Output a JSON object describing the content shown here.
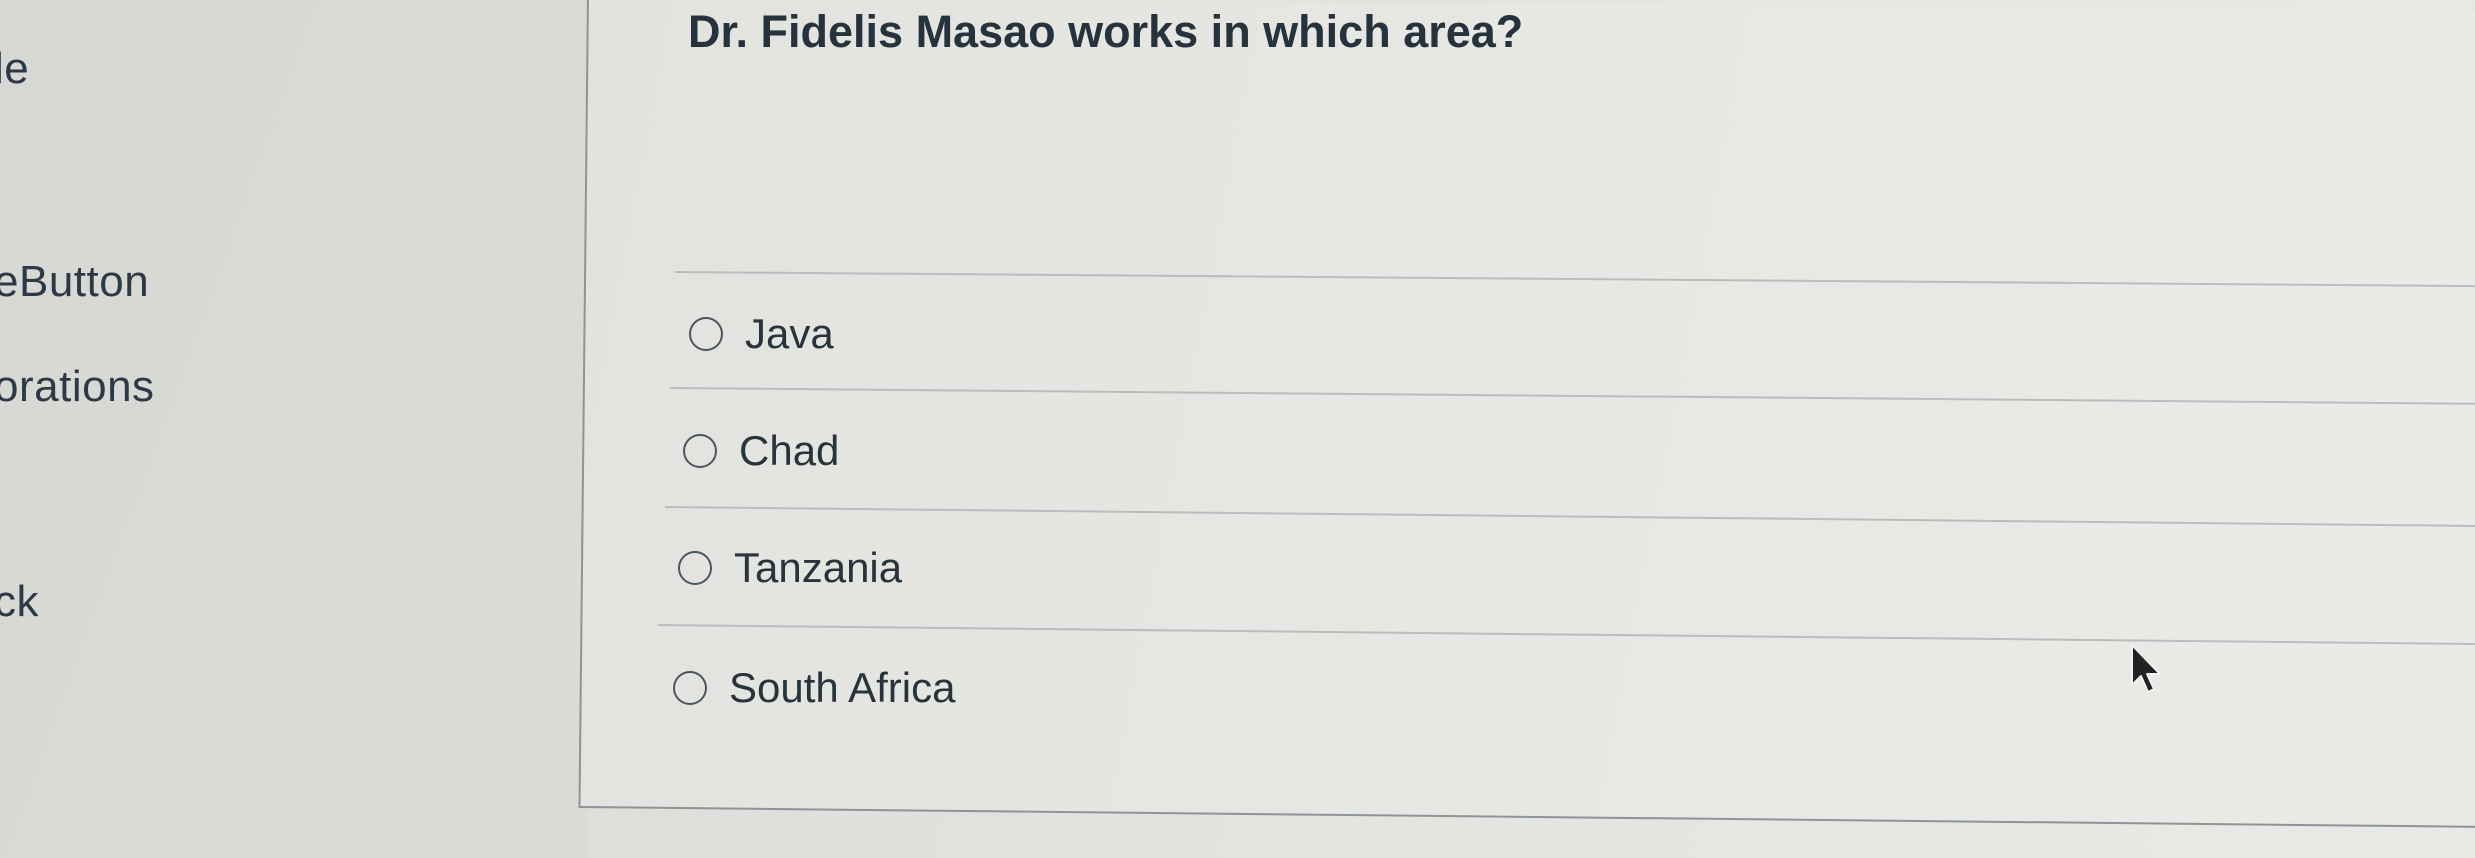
{
  "sidebar": {
    "items": [
      {
        "label": "le"
      },
      {
        "label": "eButton"
      },
      {
        "label": "orations"
      },
      {
        "label": "ck"
      }
    ]
  },
  "question": {
    "text": "Dr. Fidelis Masao works in which area?",
    "options": [
      {
        "label": "Java",
        "selected": false
      },
      {
        "label": "Chad",
        "selected": false
      },
      {
        "label": "Tanzania",
        "selected": false
      },
      {
        "label": "South Africa",
        "selected": false
      }
    ]
  },
  "icons": {
    "radio": "radio-button-icon",
    "cursor": "mouse-pointer-icon"
  }
}
